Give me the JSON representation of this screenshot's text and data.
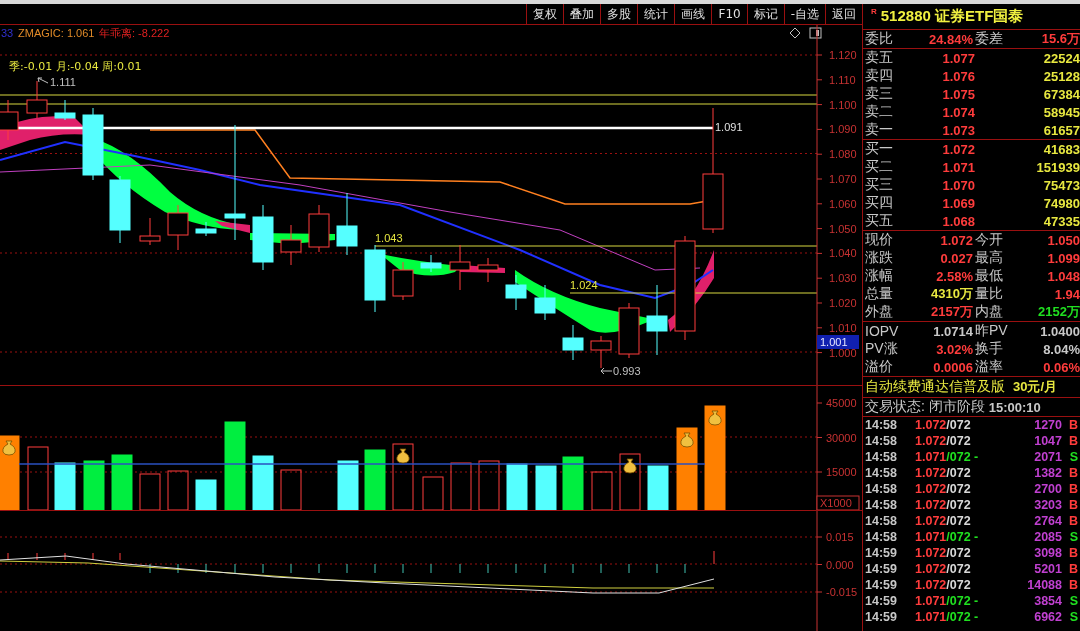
{
  "toolbar": {
    "buttons": [
      "复权",
      "叠加",
      "多股",
      "统计",
      "画线",
      "F10",
      "标记",
      "-自选",
      "返回"
    ]
  },
  "chart": {
    "legend": [
      {
        "text": "33",
        "color": "#3030d0"
      },
      {
        "text": "ZMAGIC: 1.061",
        "color": "#e08a28"
      },
      {
        "text": "年乖离: -8.222",
        "color": "#e02020"
      }
    ],
    "period_change": "季:-0.01 月:-0.04 周:0.01",
    "high_label": "1.111",
    "low_label": "0.993",
    "line_labels": [
      "1.091",
      "1.043",
      "1.024"
    ],
    "price_axis": [
      "1.120",
      "1.110",
      "1.100",
      "1.090",
      "1.080",
      "1.070",
      "1.060",
      "1.050",
      "1.040",
      "1.030",
      "1.020",
      "1.010",
      "1.000"
    ],
    "current_tag": "1.001",
    "volume_axis": [
      "45000",
      "30000",
      "15000"
    ],
    "volume_unit": "X1000",
    "indicator_axis": [
      "0.015",
      "0.000",
      "-0.015"
    ]
  },
  "quote": {
    "mark": "R",
    "title": "512880 证券ETF国泰",
    "order_ratio": [
      {
        "label": "委比",
        "value": "24.84%"
      },
      {
        "label": "委差",
        "value": "15.6万"
      }
    ],
    "asks": [
      {
        "label": "卖五",
        "price": "1.077",
        "volume": "22524"
      },
      {
        "label": "卖四",
        "price": "1.076",
        "volume": "25128"
      },
      {
        "label": "卖三",
        "price": "1.075",
        "volume": "67384"
      },
      {
        "label": "卖二",
        "price": "1.074",
        "volume": "58945"
      },
      {
        "label": "卖一",
        "price": "1.073",
        "volume": "61657"
      }
    ],
    "bids": [
      {
        "label": "买一",
        "price": "1.072",
        "volume": "41683"
      },
      {
        "label": "买二",
        "price": "1.071",
        "volume": "151939"
      },
      {
        "label": "买三",
        "price": "1.070",
        "volume": "75473"
      },
      {
        "label": "买四",
        "price": "1.069",
        "volume": "74980"
      },
      {
        "label": "买五",
        "price": "1.068",
        "volume": "47335"
      }
    ],
    "stats": [
      {
        "label": "现价",
        "value": "1.072",
        "color": "#ff3c3c"
      },
      {
        "label": "今开",
        "value": "1.050",
        "color": "#ff3c3c"
      },
      {
        "label": "涨跌",
        "value": "0.027",
        "color": "#ff3c3c"
      },
      {
        "label": "最高",
        "value": "1.099",
        "color": "#ff3c3c"
      },
      {
        "label": "涨幅",
        "value": "2.58%",
        "color": "#ff3c3c"
      },
      {
        "label": "最低",
        "value": "1.048",
        "color": "#ff3c3c"
      },
      {
        "label": "总量",
        "value": "4310万",
        "color": "#e8e840"
      },
      {
        "label": "量比",
        "value": "1.94",
        "color": "#ff3c3c"
      },
      {
        "label": "外盘",
        "value": "2157万",
        "color": "#ff3c3c"
      },
      {
        "label": "内盘",
        "value": "2152万",
        "color": "#20e020"
      }
    ],
    "fund": [
      {
        "label": "IOPV",
        "value": "1.0714",
        "color": "#c8c8c8"
      },
      {
        "label": "昨PV",
        "value": "1.0400",
        "color": "#c8c8c8"
      },
      {
        "label": "PV涨",
        "value": "3.02%",
        "color": "#ff3c3c"
      },
      {
        "label": "换手",
        "value": "8.04%",
        "color": "#c8c8c8"
      },
      {
        "label": "溢价",
        "value": "0.0006",
        "color": "#ff3c3c"
      },
      {
        "label": "溢率",
        "value": "0.06%",
        "color": "#ff3c3c"
      }
    ],
    "ad": {
      "text": "自动续费通达信普及版",
      "price": "30元/月"
    },
    "status": {
      "text": "交易状态: 闭市阶段",
      "time": "15:00:10"
    },
    "ticks": [
      {
        "time": "14:58",
        "price": "1.072",
        "suffix": "/072",
        "volume": "1270",
        "side": "B",
        "kind": "buy"
      },
      {
        "time": "14:58",
        "price": "1.072",
        "suffix": "/072",
        "volume": "1047",
        "side": "B",
        "kind": "buy"
      },
      {
        "time": "14:58",
        "price": "1.071",
        "suffix": "/072 -",
        "volume": "2071",
        "side": "S",
        "kind": "sell"
      },
      {
        "time": "14:58",
        "price": "1.072",
        "suffix": "/072",
        "volume": "1382",
        "side": "B",
        "kind": "buy"
      },
      {
        "time": "14:58",
        "price": "1.072",
        "suffix": "/072",
        "volume": "2700",
        "side": "B",
        "kind": "buy"
      },
      {
        "time": "14:58",
        "price": "1.072",
        "suffix": "/072",
        "volume": "3203",
        "side": "B",
        "kind": "buy"
      },
      {
        "time": "14:58",
        "price": "1.072",
        "suffix": "/072",
        "volume": "2764",
        "side": "B",
        "kind": "buy"
      },
      {
        "time": "14:58",
        "price": "1.071",
        "suffix": "/072 -",
        "volume": "2085",
        "side": "S",
        "kind": "sell"
      },
      {
        "time": "14:59",
        "price": "1.072",
        "suffix": "/072",
        "volume": "3098",
        "side": "B",
        "kind": "buy"
      },
      {
        "time": "14:59",
        "price": "1.072",
        "suffix": "/072",
        "volume": "5201",
        "side": "B",
        "kind": "buy"
      },
      {
        "time": "14:59",
        "price": "1.072",
        "suffix": "/072",
        "volume": "14088",
        "side": "B",
        "kind": "buy"
      },
      {
        "time": "14:59",
        "price": "1.071",
        "suffix": "/072 -",
        "volume": "3854",
        "side": "S",
        "kind": "sell"
      },
      {
        "time": "14:59",
        "price": "1.071",
        "suffix": "/072 -",
        "volume": "6962",
        "side": "S",
        "kind": "sell"
      }
    ]
  }
}
